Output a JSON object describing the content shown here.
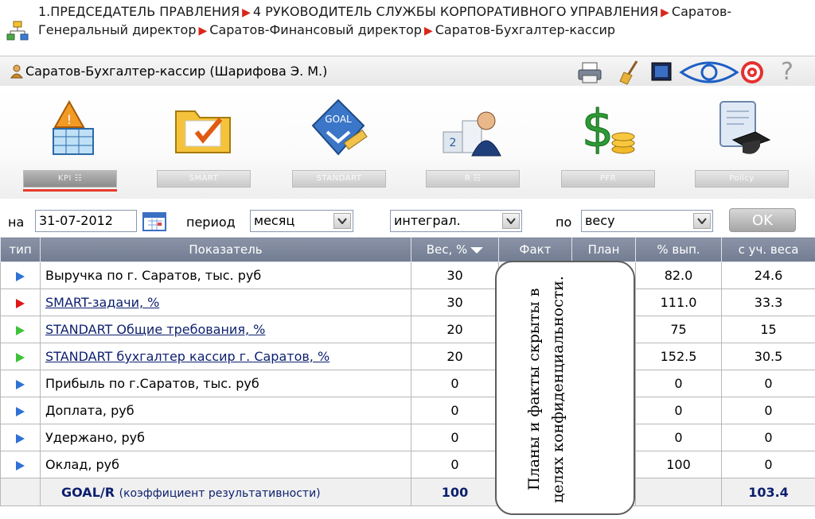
{
  "breadcrumb": {
    "items": [
      "1.ПРЕДСЕДАТЕЛЬ ПРАВЛЕНИЯ",
      "4 РУКОВОДИТЕЛЬ СЛУЖБЫ КОРПОРАТИВНОГО УПРАВЛЕНИЯ",
      "Саратов-Генеральный директор",
      "Саратов-Финансовый директор",
      "Саратов-Бухгалтер-кассир"
    ],
    "separator": "▶"
  },
  "user": {
    "name": "Саратов-Бухгалтер-кассир  (Шарифова Э. М.)"
  },
  "toolbar": {
    "help_glyph": "?"
  },
  "modules": [
    {
      "label": "KPI  ☷",
      "icon": "kpi-icon",
      "active": true
    },
    {
      "label": "SMART",
      "icon": "folder-check-icon",
      "active": false
    },
    {
      "label": "STANDART",
      "icon": "goal-badge-icon",
      "active": false
    },
    {
      "label": "R  ☷",
      "icon": "podium-icon",
      "active": false
    },
    {
      "label": "PFR",
      "icon": "dollar-coins-icon",
      "active": false
    },
    {
      "label": "Policy",
      "icon": "diploma-icon",
      "active": false
    }
  ],
  "filters": {
    "date_label": "на",
    "date_value": "31-07-2012",
    "period_label": "период",
    "period_value": "месяц",
    "mode_value": "интеграл.",
    "by_label": "по",
    "by_value": "весу",
    "ok_label": "OK"
  },
  "table": {
    "headers": [
      "тип",
      "Показатель",
      "Вес, %",
      "Факт",
      "План",
      "% вып.",
      "с уч. веса"
    ],
    "rows": [
      {
        "type": "blue",
        "name": "Выручка по г. Саратов, тыс. руб",
        "link": false,
        "weight": "30",
        "pct": "82.0",
        "weighted": "24.6"
      },
      {
        "type": "red",
        "name": "SMART-задачи, %",
        "link": true,
        "weight": "30",
        "pct": "111.0",
        "weighted": "33.3"
      },
      {
        "type": "green",
        "name": "STANDART Общие требования, %",
        "link": true,
        "weight": "20",
        "pct": "75",
        "weighted": "15"
      },
      {
        "type": "green",
        "name": "STANDART бухгалтер кассир г. Саратов, %",
        "link": true,
        "weight": "20",
        "pct": "152.5",
        "weighted": "30.5"
      },
      {
        "type": "blue",
        "name": "Прибыль по г.Саратов, тыс. руб",
        "link": false,
        "weight": "0",
        "pct": "0",
        "weighted": "0"
      },
      {
        "type": "blue",
        "name": "Доплата, руб",
        "link": false,
        "weight": "0",
        "pct": "0",
        "weighted": "0"
      },
      {
        "type": "blue",
        "name": "Удержано, руб",
        "link": false,
        "weight": "0",
        "pct": "0",
        "weighted": "0"
      },
      {
        "type": "blue",
        "name": "Оклад, руб",
        "link": false,
        "weight": "0",
        "pct": "100",
        "weighted": "0"
      }
    ],
    "total": {
      "label": "GOAL/R",
      "sublabel": "(коэффициент результативности)",
      "weight": "100",
      "weighted": "103.4"
    }
  },
  "overlay": {
    "text": "Планы и факты скрыты в целях конфиденциальности."
  },
  "colors": {
    "header_bg": "#7d879c",
    "active_underline": "#e53b2b",
    "link": "#0c1f6e",
    "arrow_blue": "#2f72d6",
    "arrow_red": "#e01818",
    "arrow_green": "#3fc23b"
  }
}
